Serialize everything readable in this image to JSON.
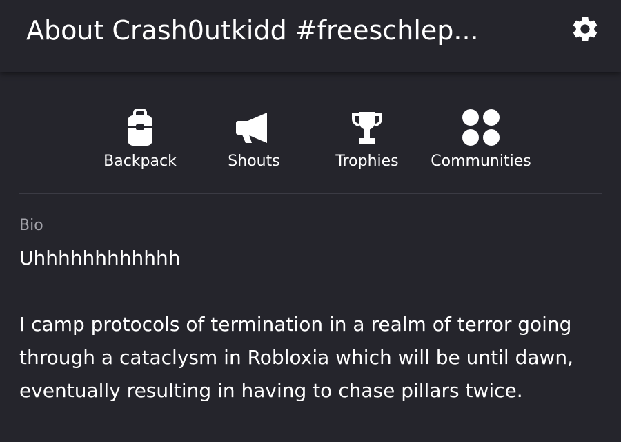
{
  "header": {
    "title": "About Crash0utkidd #freeschlep...",
    "settings_icon": "gear-icon"
  },
  "nav": {
    "items": [
      {
        "label": "Backpack",
        "icon": "backpack-icon"
      },
      {
        "label": "Shouts",
        "icon": "megaphone-icon"
      },
      {
        "label": "Trophies",
        "icon": "trophy-icon"
      },
      {
        "label": "Communities",
        "icon": "communities-icon"
      }
    ]
  },
  "bio": {
    "label": "Bio",
    "text": "Uhhhhhhhhhhhh\n\nI camp protocols of termination in a realm of terror going through a cataclysm in Robloxia which will be until dawn, eventually resulting in having to chase pillars twice."
  },
  "colors": {
    "background": "#25252c",
    "text": "#ffffff",
    "muted": "#a3a3aa",
    "divider": "#3b3b44"
  }
}
